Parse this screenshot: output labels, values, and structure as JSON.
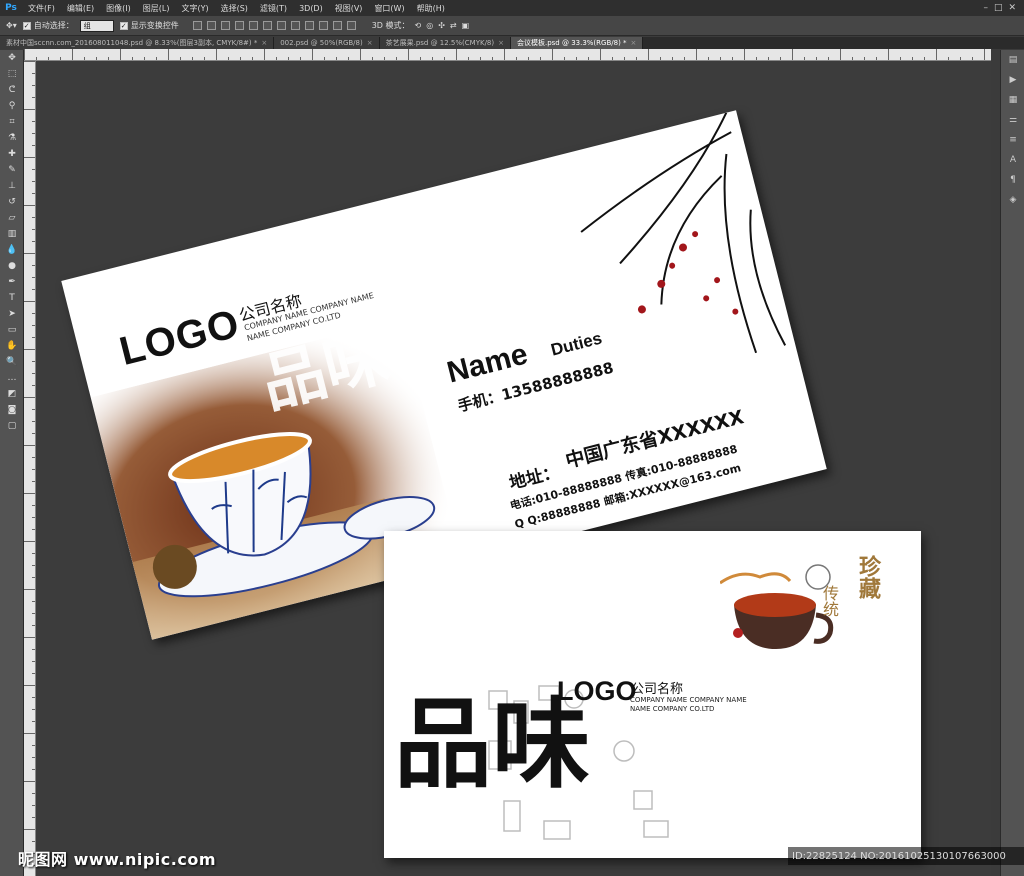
{
  "app": {
    "logo": "Ps"
  },
  "menu": [
    "文件(F)",
    "编辑(E)",
    "图像(I)",
    "图层(L)",
    "文字(Y)",
    "选择(S)",
    "滤镜(T)",
    "3D(D)",
    "视图(V)",
    "窗口(W)",
    "帮助(H)"
  ],
  "options": {
    "auto_select_label": "自动选择：",
    "auto_select_value": "组",
    "show_transform_label": "显示变换控件",
    "mode_3d_label": "3D 模式："
  },
  "tabs": [
    {
      "label": "素材中国sccnn.com_20160801104​8.psd @ 8.33%(图层3副本, CMYK/8#) *"
    },
    {
      "label": "002.psd @ 50%(RGB/8)"
    },
    {
      "label": "茶艺展果.psd @ 12.5%(CMYK/8)"
    },
    {
      "label": "会议模板.psd @ 33.3%(RGB/8) *"
    }
  ],
  "card1": {
    "logo": "LOGO",
    "company_cn": "公司名称",
    "company_en1": "COMPANY NAME COMPANY NAME",
    "company_en2": "NAME COMPANY CO.LTD",
    "name": "Name",
    "duties": "Duties",
    "phone": "手机：13588888888",
    "province": "中国广东省XXXXXX",
    "address": "地址：",
    "tel_fax": "电话:010-88888888  传真:010-88888888",
    "qq_email": "Q Q:88888888  邮箱:XXXXXX@163.com",
    "calligraphy": "品味"
  },
  "card2": {
    "logo": "LOGO",
    "company_cn": "公司名称",
    "company_en1": "COMPANY NAME COMPANY NAME",
    "company_en2": "NAME COMPANY CO.LTD",
    "calligraphy": "品味",
    "zhencang": "珍藏",
    "chuantong": "传统"
  },
  "watermark": {
    "left": "昵图网 www.nipic.com",
    "right": "ID:22825124 NO:20161025130107663000"
  },
  "colors": {
    "accent_gold": "#a0783a",
    "workspace": "#3b3b3b",
    "ps_blue": "#31a8ff"
  }
}
